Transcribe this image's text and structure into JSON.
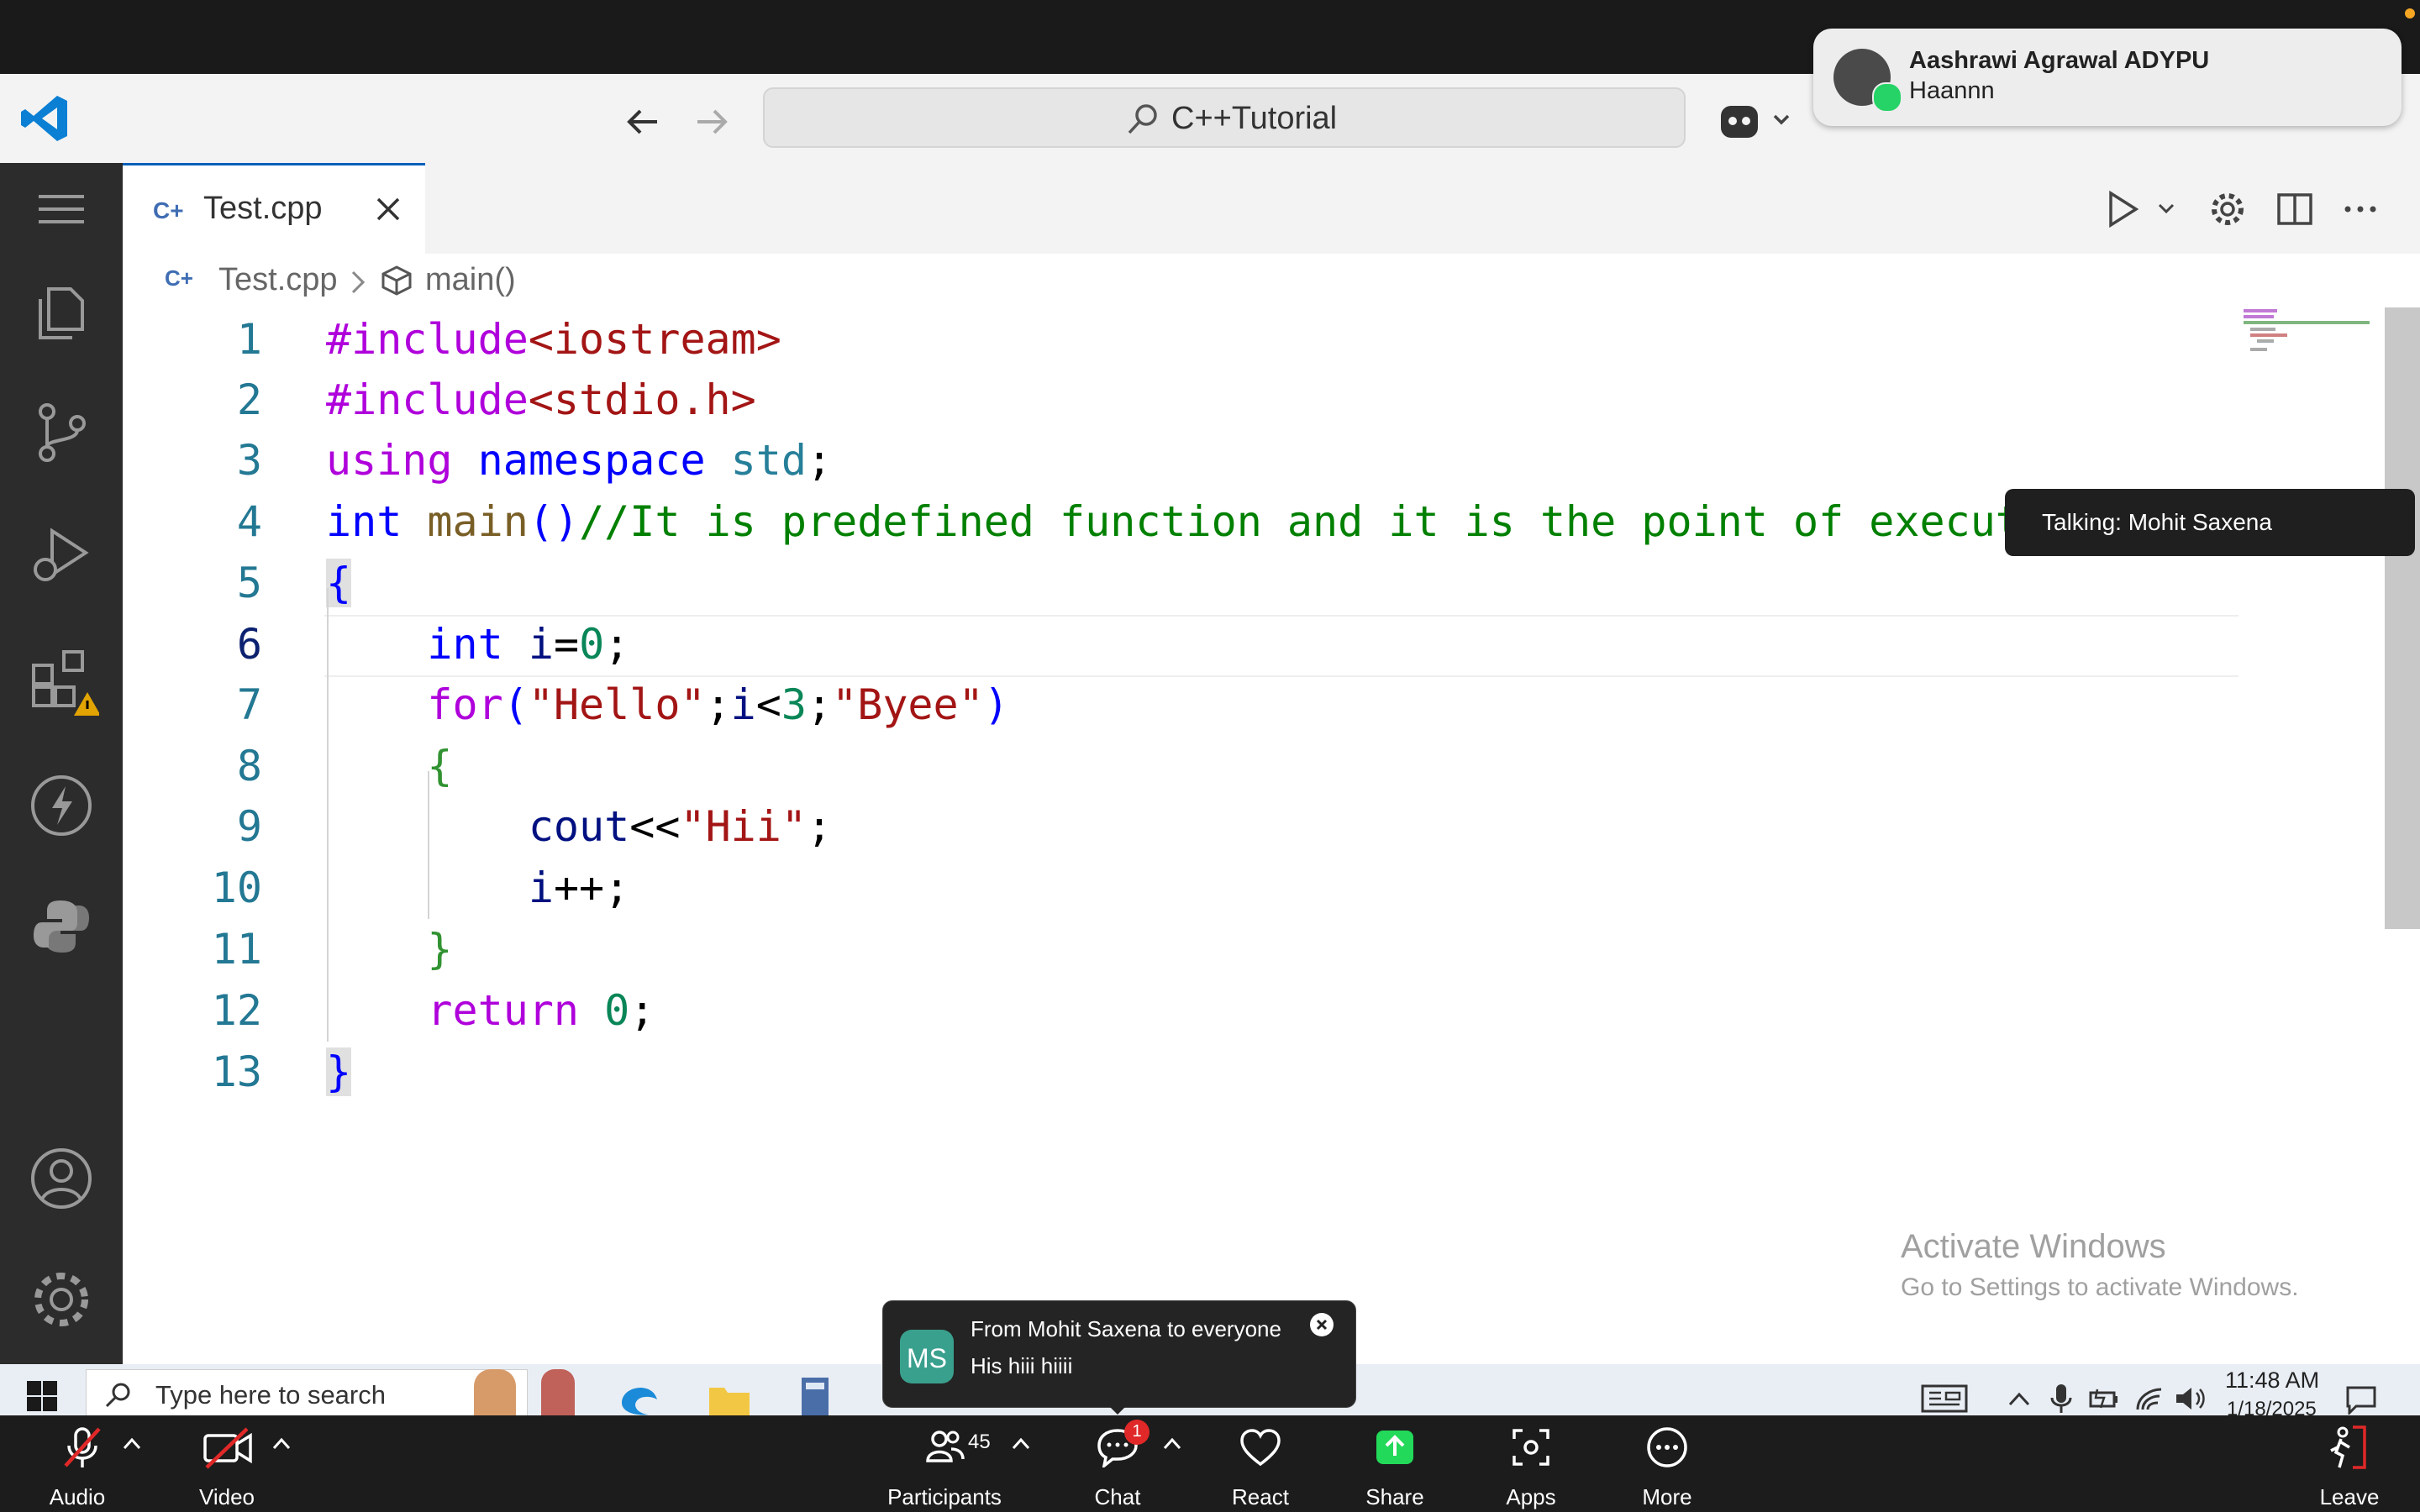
{
  "notification": {
    "name": "Aashrawi Agrawal ADYPU",
    "message": "Haannn"
  },
  "titlebar": {
    "search_text": "C++Tutorial"
  },
  "tab": {
    "label": "Test.cpp"
  },
  "breadcrumb": {
    "file": "Test.cpp",
    "symbol": "main()"
  },
  "talking": {
    "text": "Talking: Mohit Saxena"
  },
  "editor": {
    "line_numbers": [
      "1",
      "2",
      "3",
      "4",
      "5",
      "6",
      "7",
      "8",
      "9",
      "10",
      "11",
      "12",
      "13"
    ]
  },
  "watermark": {
    "title": "Activate Windows",
    "subtitle": "Go to Settings to activate Windows."
  },
  "chat_popup": {
    "initials": "MS",
    "header": "From Mohit Saxena to everyone",
    "message": "His hiii hiiii"
  },
  "taskbar": {
    "search_placeholder": "Type here to search",
    "time": "11:48 AM",
    "date": "1/18/2025"
  },
  "zoom": {
    "audio": "Audio",
    "video": "Video",
    "participants": "Participants",
    "participants_count": "45",
    "chat": "Chat",
    "chat_badge": "1",
    "react": "React",
    "share": "Share",
    "apps": "Apps",
    "more": "More",
    "leave": "Leave"
  },
  "colors": {
    "accent": "#005fb8",
    "share_green": "#23d959",
    "zoom_red": "#e02828"
  }
}
